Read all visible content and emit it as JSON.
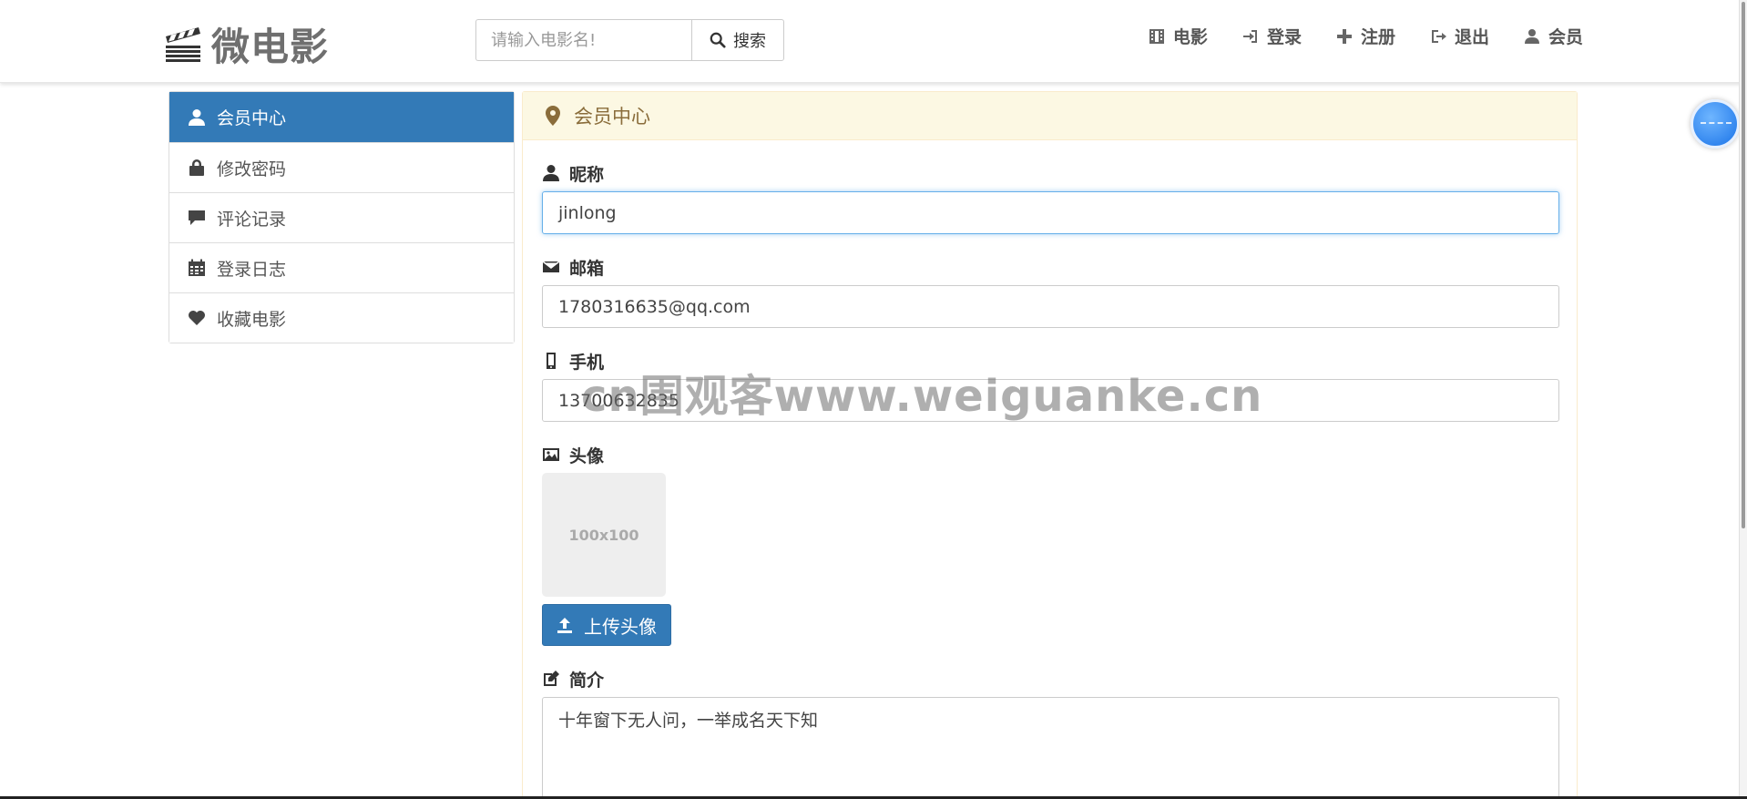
{
  "brand": {
    "name": "微电影"
  },
  "search": {
    "placeholder": "请输入电影名!",
    "button_label": "搜索"
  },
  "nav": [
    {
      "label": "电影",
      "icon": "film-icon"
    },
    {
      "label": "登录",
      "icon": "login-icon"
    },
    {
      "label": "注册",
      "icon": "plus-icon"
    },
    {
      "label": "退出",
      "icon": "logout-icon"
    },
    {
      "label": "会员",
      "icon": "user-icon"
    }
  ],
  "sidebar": {
    "items": [
      {
        "label": "会员中心",
        "icon": "user-icon",
        "active": true
      },
      {
        "label": "修改密码",
        "icon": "lock-icon",
        "active": false
      },
      {
        "label": "评论记录",
        "icon": "comment-icon",
        "active": false
      },
      {
        "label": "登录日志",
        "icon": "calendar-icon",
        "active": false
      },
      {
        "label": "收藏电影",
        "icon": "heart-icon",
        "active": false
      }
    ]
  },
  "panel": {
    "title": "会员中心",
    "nickname": {
      "label": "昵称",
      "value": "jinlong"
    },
    "email": {
      "label": "邮箱",
      "value": "1780316635@qq.com"
    },
    "phone": {
      "label": "手机",
      "value": "13700632835"
    },
    "avatar": {
      "label": "头像",
      "placeholder": "100x100",
      "upload_label": "上传头像"
    },
    "intro": {
      "label": "简介",
      "value": "十年窗下无人问，一举成名天下知"
    }
  },
  "watermark": "cn围观客www.weiguanke.cn",
  "colors": {
    "primary": "#337ab7",
    "panel_heading_bg": "#fcf8e3",
    "panel_heading_text": "#8a6d3b"
  }
}
